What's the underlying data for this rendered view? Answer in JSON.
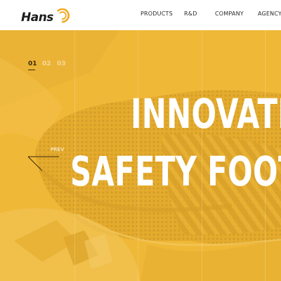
{
  "header": {
    "logo_text": "Hans",
    "nav": [
      {
        "label": "PRODUCTS"
      },
      {
        "label": "R&D"
      },
      {
        "label": "COMPANY"
      },
      {
        "label": "AGENCY"
      }
    ]
  },
  "hero": {
    "slides": [
      "01",
      "02",
      "03"
    ],
    "active_slide": 0,
    "headline_line1": "INNOVATI",
    "headline_line2": "SAFETY FOOT",
    "prev_label": "PREV"
  },
  "colors": {
    "brand_yellow": "#efb937",
    "logo_orange": "#f2a81d",
    "text_dark": "#2a2a2a",
    "header_bg": "#ffffff"
  },
  "icons": [
    "hans-logo",
    "prev-arrow-icon"
  ]
}
